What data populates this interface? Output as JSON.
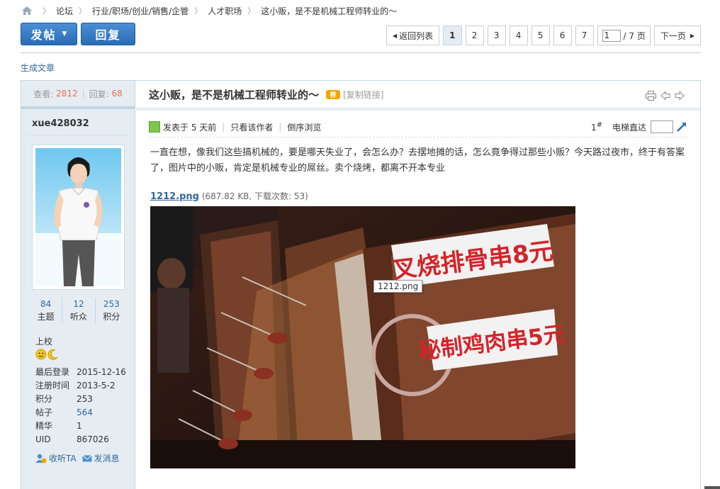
{
  "breadcrumb": [
    "论坛",
    "行业/职场/创业/销售/企管",
    "人才职场",
    "这小贩，是不是机械工程师转业的～"
  ],
  "toolbar": {
    "post_label": "发帖",
    "reply_label": "回复"
  },
  "pager": {
    "back_label": "返回列表",
    "pages": [
      "1",
      "2",
      "3",
      "4",
      "5",
      "6",
      "7"
    ],
    "current_page": "1",
    "total_label": "/ 7 页",
    "next_label": "下一页"
  },
  "generate_article": "生成文章",
  "stats": {
    "views_label": "查看:",
    "views": "2812",
    "replies_label": "回复:",
    "replies": "68"
  },
  "author": {
    "name": "xue428032",
    "counts": [
      {
        "value": "84",
        "label": "主题"
      },
      {
        "value": "12",
        "label": "听众"
      },
      {
        "value": "253",
        "label": "积分"
      }
    ],
    "rank": "上校",
    "info": [
      {
        "k": "最后登录",
        "v": "2015-12-16"
      },
      {
        "k": "注册时间",
        "v": "2013-5-2"
      },
      {
        "k": "积分",
        "v": "253"
      },
      {
        "k": "帖子",
        "v": "564"
      },
      {
        "k": "精华",
        "v": "1"
      },
      {
        "k": "UID",
        "v": "867026"
      }
    ],
    "listen_label": "收听TA",
    "message_label": "发消息"
  },
  "post": {
    "title": "这小贩，是不是机械工程师转业的～",
    "recommend_tag": "荐",
    "copy_link": "[复制链接]",
    "posted_label": "发表于 5 天前",
    "only_author": "只看该作者",
    "reverse": "倒序浏览",
    "floor": "1",
    "floor_suffix": "#",
    "jump_label": "电梯直达",
    "content": "一直在想，像我们这些搞机械的，要是哪天失业了，会怎么办？去摆地摊的话，怎么竟争得过那些小贩？今天路过夜市，终于有答案了，图片中的小贩，肯定是机械专业的屌丝。卖个烧烤，都离不开本专业",
    "attachment": {
      "filename": "1212.png",
      "meta": "(687.82 KB, 下载次数: 53)"
    },
    "tooltip": "1212.png",
    "sign1": "叉烧排骨串8元",
    "sign2": "秘制鸡肉串5元"
  },
  "colors": {
    "accent": "#2a6cb5",
    "link": "#336699",
    "sidebar_bg": "#e5edf2",
    "sign_red": "#d3242a"
  }
}
